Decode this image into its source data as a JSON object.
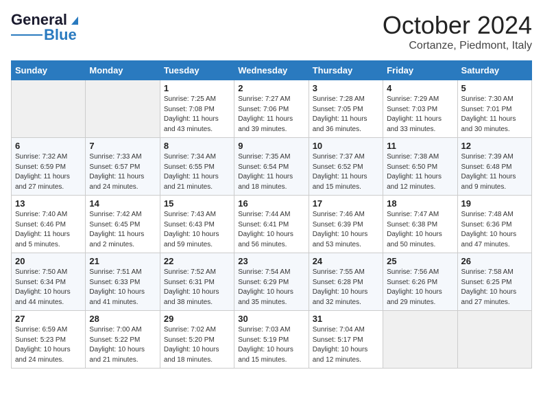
{
  "header": {
    "logo_general": "General",
    "logo_blue": "Blue",
    "month_title": "October 2024",
    "location": "Cortanze, Piedmont, Italy"
  },
  "days_of_week": [
    "Sunday",
    "Monday",
    "Tuesday",
    "Wednesday",
    "Thursday",
    "Friday",
    "Saturday"
  ],
  "weeks": [
    [
      {
        "day": null
      },
      {
        "day": null
      },
      {
        "day": "1",
        "sunrise": "7:25 AM",
        "sunset": "7:08 PM",
        "daylight": "11 hours and 43 minutes."
      },
      {
        "day": "2",
        "sunrise": "7:27 AM",
        "sunset": "7:06 PM",
        "daylight": "11 hours and 39 minutes."
      },
      {
        "day": "3",
        "sunrise": "7:28 AM",
        "sunset": "7:05 PM",
        "daylight": "11 hours and 36 minutes."
      },
      {
        "day": "4",
        "sunrise": "7:29 AM",
        "sunset": "7:03 PM",
        "daylight": "11 hours and 33 minutes."
      },
      {
        "day": "5",
        "sunrise": "7:30 AM",
        "sunset": "7:01 PM",
        "daylight": "11 hours and 30 minutes."
      }
    ],
    [
      {
        "day": "6",
        "sunrise": "7:32 AM",
        "sunset": "6:59 PM",
        "daylight": "11 hours and 27 minutes."
      },
      {
        "day": "7",
        "sunrise": "7:33 AM",
        "sunset": "6:57 PM",
        "daylight": "11 hours and 24 minutes."
      },
      {
        "day": "8",
        "sunrise": "7:34 AM",
        "sunset": "6:55 PM",
        "daylight": "11 hours and 21 minutes."
      },
      {
        "day": "9",
        "sunrise": "7:35 AM",
        "sunset": "6:54 PM",
        "daylight": "11 hours and 18 minutes."
      },
      {
        "day": "10",
        "sunrise": "7:37 AM",
        "sunset": "6:52 PM",
        "daylight": "11 hours and 15 minutes."
      },
      {
        "day": "11",
        "sunrise": "7:38 AM",
        "sunset": "6:50 PM",
        "daylight": "11 hours and 12 minutes."
      },
      {
        "day": "12",
        "sunrise": "7:39 AM",
        "sunset": "6:48 PM",
        "daylight": "11 hours and 9 minutes."
      }
    ],
    [
      {
        "day": "13",
        "sunrise": "7:40 AM",
        "sunset": "6:46 PM",
        "daylight": "11 hours and 5 minutes."
      },
      {
        "day": "14",
        "sunrise": "7:42 AM",
        "sunset": "6:45 PM",
        "daylight": "11 hours and 2 minutes."
      },
      {
        "day": "15",
        "sunrise": "7:43 AM",
        "sunset": "6:43 PM",
        "daylight": "10 hours and 59 minutes."
      },
      {
        "day": "16",
        "sunrise": "7:44 AM",
        "sunset": "6:41 PM",
        "daylight": "10 hours and 56 minutes."
      },
      {
        "day": "17",
        "sunrise": "7:46 AM",
        "sunset": "6:39 PM",
        "daylight": "10 hours and 53 minutes."
      },
      {
        "day": "18",
        "sunrise": "7:47 AM",
        "sunset": "6:38 PM",
        "daylight": "10 hours and 50 minutes."
      },
      {
        "day": "19",
        "sunrise": "7:48 AM",
        "sunset": "6:36 PM",
        "daylight": "10 hours and 47 minutes."
      }
    ],
    [
      {
        "day": "20",
        "sunrise": "7:50 AM",
        "sunset": "6:34 PM",
        "daylight": "10 hours and 44 minutes."
      },
      {
        "day": "21",
        "sunrise": "7:51 AM",
        "sunset": "6:33 PM",
        "daylight": "10 hours and 41 minutes."
      },
      {
        "day": "22",
        "sunrise": "7:52 AM",
        "sunset": "6:31 PM",
        "daylight": "10 hours and 38 minutes."
      },
      {
        "day": "23",
        "sunrise": "7:54 AM",
        "sunset": "6:29 PM",
        "daylight": "10 hours and 35 minutes."
      },
      {
        "day": "24",
        "sunrise": "7:55 AM",
        "sunset": "6:28 PM",
        "daylight": "10 hours and 32 minutes."
      },
      {
        "day": "25",
        "sunrise": "7:56 AM",
        "sunset": "6:26 PM",
        "daylight": "10 hours and 29 minutes."
      },
      {
        "day": "26",
        "sunrise": "7:58 AM",
        "sunset": "6:25 PM",
        "daylight": "10 hours and 27 minutes."
      }
    ],
    [
      {
        "day": "27",
        "sunrise": "6:59 AM",
        "sunset": "5:23 PM",
        "daylight": "10 hours and 24 minutes."
      },
      {
        "day": "28",
        "sunrise": "7:00 AM",
        "sunset": "5:22 PM",
        "daylight": "10 hours and 21 minutes."
      },
      {
        "day": "29",
        "sunrise": "7:02 AM",
        "sunset": "5:20 PM",
        "daylight": "10 hours and 18 minutes."
      },
      {
        "day": "30",
        "sunrise": "7:03 AM",
        "sunset": "5:19 PM",
        "daylight": "10 hours and 15 minutes."
      },
      {
        "day": "31",
        "sunrise": "7:04 AM",
        "sunset": "5:17 PM",
        "daylight": "10 hours and 12 minutes."
      },
      {
        "day": null
      },
      {
        "day": null
      }
    ]
  ]
}
